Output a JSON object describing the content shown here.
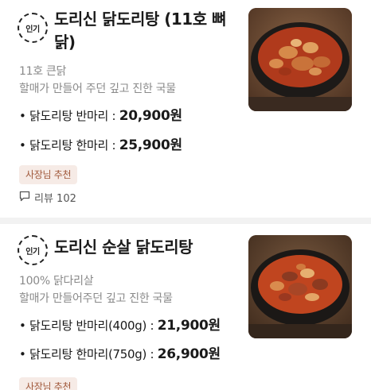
{
  "items": [
    {
      "badge": "인기",
      "title": "도리신 닭도리탕 (11호 뼈닭)",
      "desc1": "11호 큰닭",
      "desc2": "할매가 만들어 주던 깊고 진한 국물",
      "prices": [
        {
          "label": "• 닭도리탕 반마리 : ",
          "amount": "20,900원"
        },
        {
          "label": "• 닭도리탕 한마리 : ",
          "amount": "25,900원"
        }
      ],
      "tag": "사장님 추천",
      "reviews": "리뷰 102",
      "image_icon": "braised-chicken-photo"
    },
    {
      "badge": "인기",
      "title": "도리신 순살 닭도리탕",
      "desc1": "100% 닭다리살",
      "desc2": "할매가 만들어주던 깊고 진한 국물",
      "prices": [
        {
          "label": "• 닭도리탕 반마리(400g) : ",
          "amount": "21,900원"
        },
        {
          "label": "• 닭도리탕 한마리(750g) : ",
          "amount": "26,900원"
        }
      ],
      "tag": "사장님 추천",
      "image_icon": "boneless-braised-chicken-photo"
    }
  ],
  "colors": {
    "tag_bg": "#f6ebe6",
    "tag_text": "#a0583a",
    "desc_text": "#8a8a8a",
    "divider": "#f2f2f2"
  }
}
